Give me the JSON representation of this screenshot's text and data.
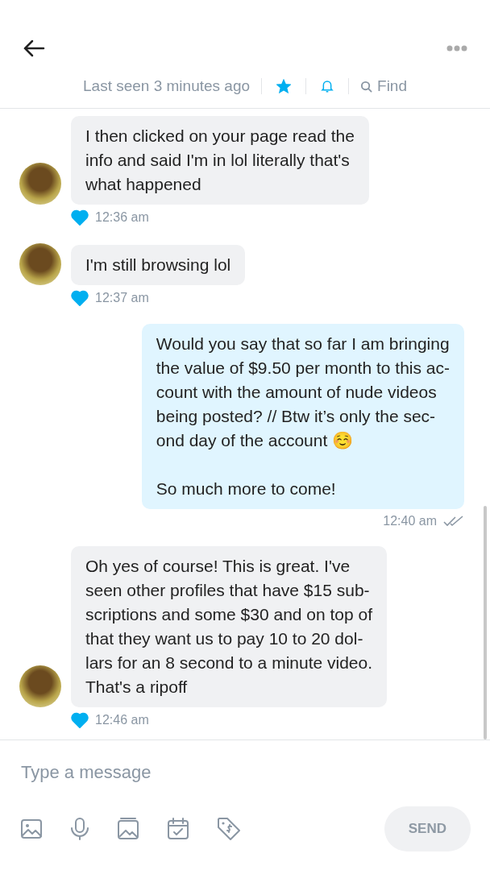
{
  "header": {
    "status": "Last seen 3 minutes ago",
    "favorite": true,
    "find_label": "Find"
  },
  "messages": [
    {
      "kind": "incoming",
      "text": "I then clicked on your page read the\ninfo and said I'm in lol literally that's\nwhat happened",
      "time": "12:36 am",
      "liked": true
    },
    {
      "kind": "incoming",
      "text": "I'm still browsing lol",
      "time": "12:37 am",
      "liked": true
    },
    {
      "kind": "outgoing",
      "text": "Would you say that so far I am bringing\nthe value of $9.50 per month to this ac-\ncount with the amount of nude videos\nbeing posted? // Btw it’s only the sec-\nond day of the account ☺️\n\nSo much more to come!",
      "time": "12:40 am",
      "read": true
    },
    {
      "kind": "incoming",
      "text": "Oh yes of course! This is great. I've\nseen other profiles that have $15 sub-\nscriptions and some $30 and on top of\nthat they want us to pay 10 to 20 dol-\nlars for an 8 second to a minute video.\nThat's a ripoff",
      "time": "12:46 am",
      "liked": true
    }
  ],
  "composer": {
    "placeholder": "Type a message",
    "send_label": "SEND",
    "send_disabled": true
  }
}
